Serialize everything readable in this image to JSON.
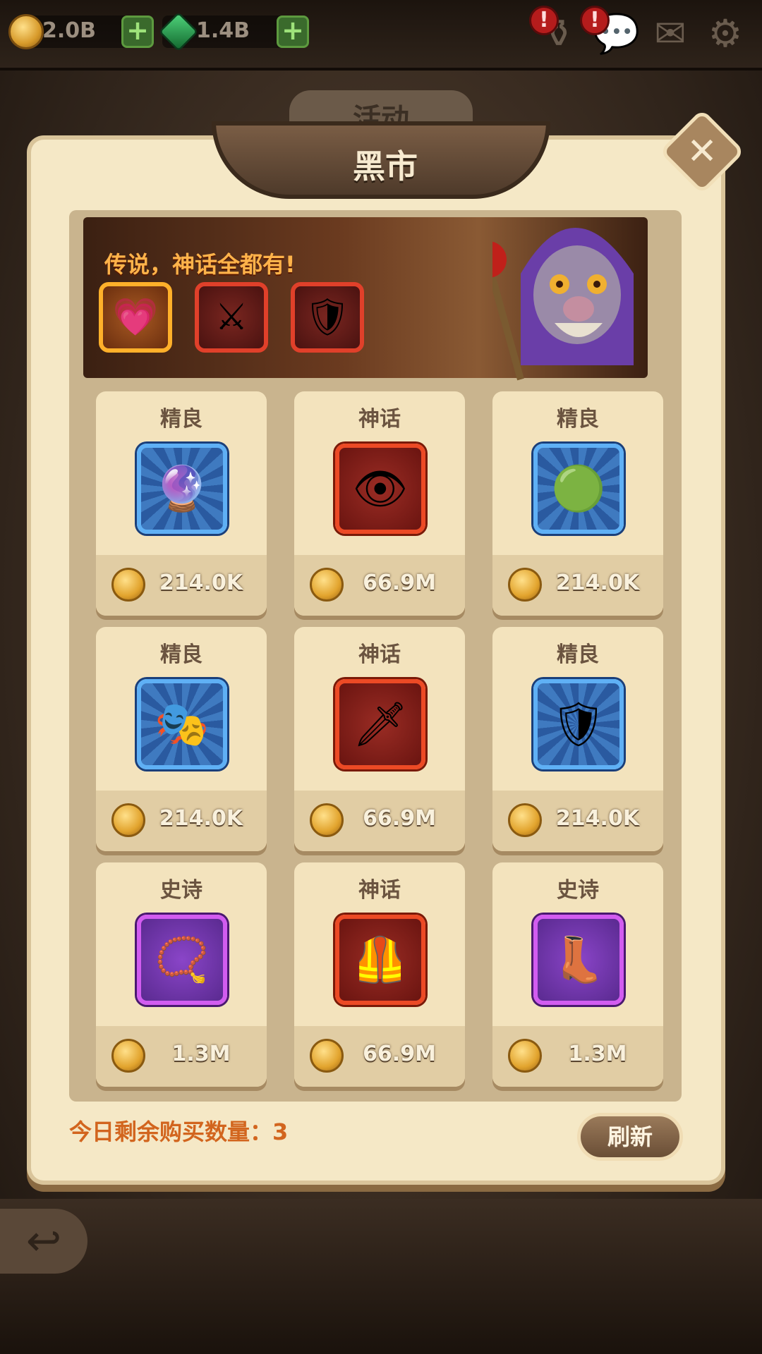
{
  "resources": {
    "gold": "2.0B",
    "gems": "1.4B"
  },
  "background_tab": "活动",
  "title": "黑市",
  "banner": {
    "slogan": "传说，神话全都有!"
  },
  "cards": [
    {
      "rarity": "精良",
      "price": "214.0K",
      "frame": "blue",
      "icon": "pink-gem-amulet-icon",
      "glyph": "🔮"
    },
    {
      "rarity": "神话",
      "price": "66.9M",
      "frame": "red",
      "icon": "eyeball-amulet-icon",
      "glyph": "👁"
    },
    {
      "rarity": "精良",
      "price": "214.0K",
      "frame": "blue",
      "icon": "green-orb-necklace-icon",
      "glyph": "🟢"
    },
    {
      "rarity": "精良",
      "price": "214.0K",
      "frame": "blue",
      "icon": "silver-mask-icon",
      "glyph": "🎭"
    },
    {
      "rarity": "神话",
      "price": "66.9M",
      "frame": "red",
      "icon": "crystal-sword-icon",
      "glyph": "🗡"
    },
    {
      "rarity": "精良",
      "price": "214.0K",
      "frame": "blue",
      "icon": "dark-shield-icon",
      "glyph": "🛡"
    },
    {
      "rarity": "史诗",
      "price": "1.3M",
      "frame": "purple",
      "icon": "gold-chain-icon",
      "glyph": "📿"
    },
    {
      "rarity": "神话",
      "price": "66.9M",
      "frame": "red",
      "icon": "spiked-armor-icon",
      "glyph": "🦺"
    },
    {
      "rarity": "史诗",
      "price": "1.3M",
      "frame": "purple",
      "icon": "leather-boot-icon",
      "glyph": "👢"
    }
  ],
  "footer": {
    "remaining_label": "今日剩余购买数量：3",
    "refresh": "刷新"
  },
  "colors": {
    "panel": "#f5e8c6",
    "accent_orange": "#d2651e",
    "frame_blue": "#5fb0f5",
    "frame_red": "#ec4a25",
    "frame_purple": "#d25cf0"
  }
}
